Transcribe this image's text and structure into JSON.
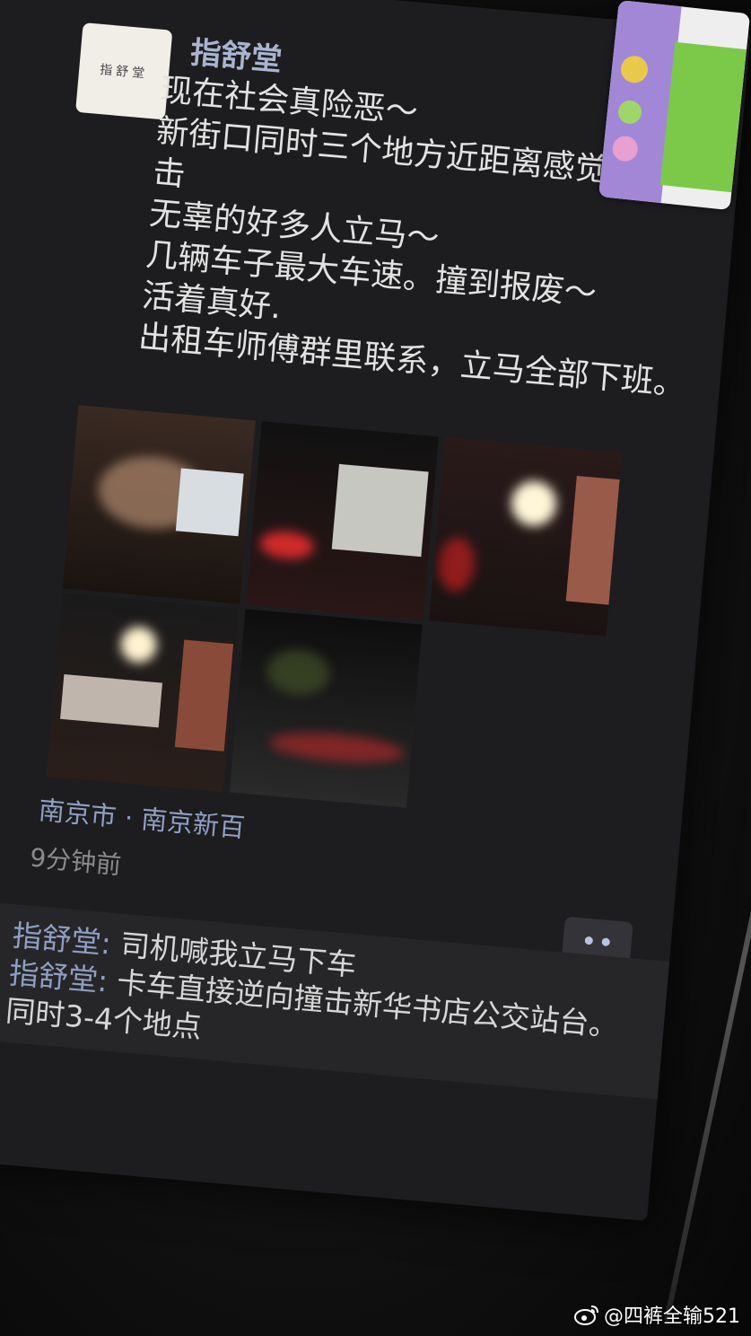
{
  "post": {
    "author": "指舒堂",
    "avatar_text": "指舒堂",
    "lines": [
      "现在社会真险恶～",
      "新街口同时三个地方近距离感觉自杀式",
      "击",
      "无辜的好多人立马～",
      "几辆车子最大车速。撞到报废～",
      "活着真好.",
      "出租车师傅群里联系，立马全部下班。"
    ],
    "photo_count": 5,
    "location": "南京市 · 南京新百",
    "time": "9分钟前"
  },
  "comments": [
    {
      "name": "指舒堂",
      "separator": ": ",
      "text": "司机喊我立马下车"
    },
    {
      "name": "指舒堂",
      "separator": ": ",
      "text": "卡车直接逆向撞击新华书店公交站台。"
    },
    {
      "name": "",
      "separator": "",
      "text": "同时3-4个地点"
    }
  ],
  "watermark": {
    "icon": "weibo-icon",
    "text": "@四裤全输521"
  },
  "colors": {
    "screen_bg": "#1d1d1f",
    "name_blue": "#8f9fc2",
    "text_light": "#e2e2e2"
  }
}
